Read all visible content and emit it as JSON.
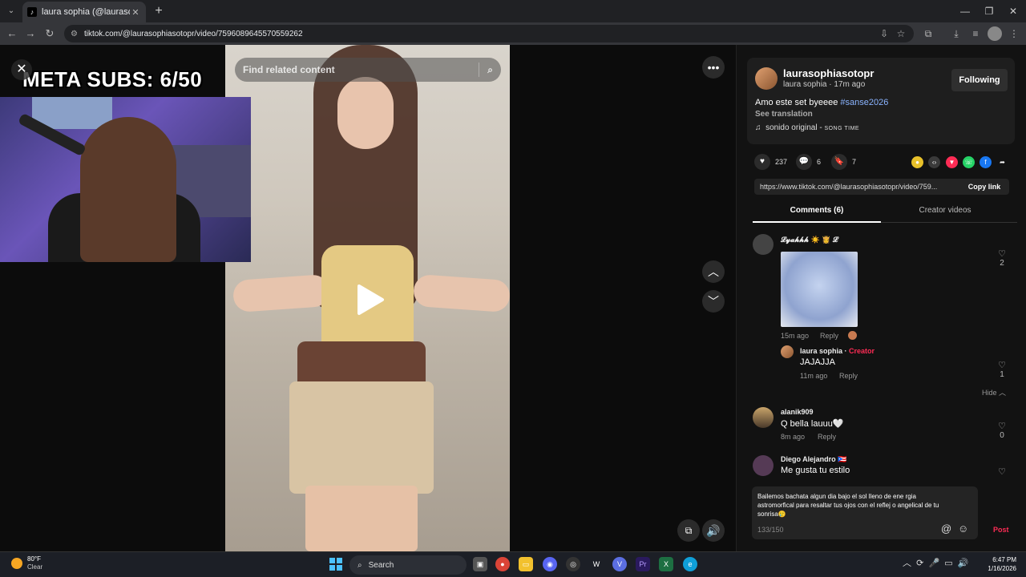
{
  "browser": {
    "tab_title": "laura sophia (@laurasophiasotopr",
    "url": "tiktok.com/@laurasophiasotopr/video/7596089645570559262"
  },
  "overlay": {
    "meta_subs": "META SUBS: 6/50"
  },
  "search": {
    "placeholder": "Find related content"
  },
  "post": {
    "username": "laurasophiasotopr",
    "display_name": "laura sophia",
    "time_ago": "17m ago",
    "follow_label": "Following",
    "caption_text": "Amo este set byeeee ",
    "caption_tag": "#sanse2026",
    "see_translation": "See translation",
    "sound_name": "sonido original - ",
    "sound_artist": "SONG TIME",
    "likes": "237",
    "comments": "6",
    "saves": "7",
    "link": "https://www.tiktok.com/@laurasophiasotopr/video/759...",
    "copy_label": "Copy link"
  },
  "tabs": {
    "comments": "Comments (6)",
    "creator": "Creator videos"
  },
  "comments": [
    {
      "name": "𝓛𝔂𝓪𝓱𝓱𝓱 ☀️ 👸 𝓛",
      "time": "15m ago",
      "reply": "Reply",
      "likes": "2"
    },
    {
      "name": "laura sophia",
      "creator_tag": "Creator",
      "text": "JAJAJJA",
      "time": "11m ago",
      "reply": "Reply",
      "likes": "1",
      "hide": "Hide"
    },
    {
      "name": "alanik909",
      "text": "Q bella lauuu🤍",
      "time": "8m ago",
      "reply": "Reply",
      "likes": "0"
    },
    {
      "name": "Diego Alejandro 🇵🇷",
      "text": "Me gusta tu estilo"
    }
  ],
  "composer": {
    "text": "Bailemos bachata algun dia bajo el sol lleno de ene rgia astromorfical para resaltar tus ojos con el reflej o angelical de tu sonrisa🥲",
    "count": "133/150",
    "post_label": "Post"
  },
  "taskbar": {
    "temp": "80°F",
    "weather": "Clear",
    "search": "Search",
    "time": "6:47 PM",
    "date": "1/16/2026"
  }
}
